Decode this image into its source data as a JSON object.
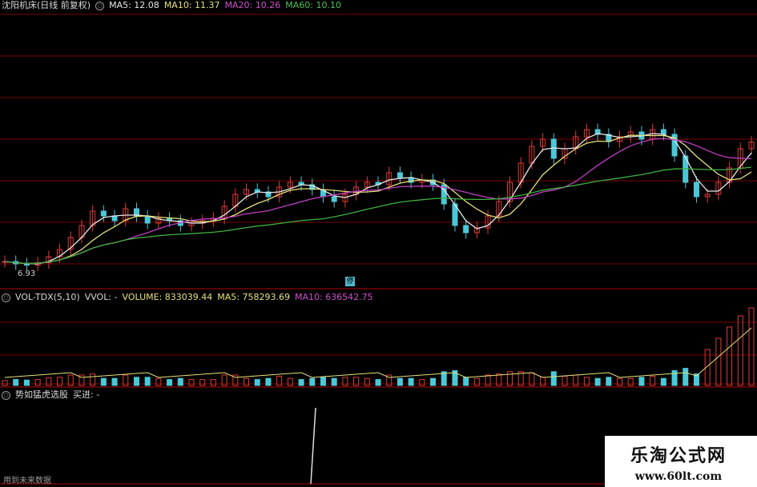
{
  "header": {
    "title": "沈阳机床(日线 前复权)",
    "ma5": "MA5: 12.08",
    "ma10": "MA10: 11.37",
    "ma20": "MA20: 10.26",
    "ma60": "MA60: 10.10"
  },
  "price_panel": {
    "low_label": "6.93",
    "stop_marker": "停"
  },
  "volume_header": {
    "name": "VOL-TDX(5,10)",
    "vvol": "VVOL: -",
    "volume": "VOLUME: 833039.44",
    "ma5": "MA5: 758293.69",
    "ma10": "MA10: 636542.75"
  },
  "indicator_header": {
    "name": "势如猛虎选股",
    "buy": "买进: -"
  },
  "footer": {
    "note": "用到未来数据"
  },
  "watermark": {
    "line1": "乐淘公式网",
    "line2": "www.60lt.com"
  },
  "colors": {
    "ma5": "#e8e8e8",
    "ma10": "#e6e07a",
    "ma20": "#c040c0",
    "ma60": "#40b040",
    "up": "#e03a3a",
    "down": "#4ac8d8",
    "grid": "#7a0000"
  },
  "chart_data": [
    {
      "type": "candlestick",
      "title": "沈阳机床(日线 前复权)",
      "series": [
        {
          "name": "MA5",
          "last": 12.08
        },
        {
          "name": "MA10",
          "last": 11.37
        },
        {
          "name": "MA20",
          "last": 10.26
        },
        {
          "name": "MA60",
          "last": 10.1
        }
      ],
      "annotations": [
        "6.93",
        "停"
      ],
      "close_trend": [
        7.1,
        7.0,
        6.95,
        7.05,
        7.3,
        7.6,
        8.1,
        8.6,
        9.2,
        9.0,
        8.8,
        9.3,
        9.0,
        8.7,
        8.9,
        8.8,
        8.6,
        8.7,
        8.8,
        8.9,
        9.4,
        9.9,
        10.1,
        10.0,
        9.8,
        10.2,
        10.4,
        10.3,
        10.1,
        9.8,
        9.6,
        9.9,
        10.2,
        10.4,
        10.3,
        10.8,
        10.6,
        10.4,
        10.5,
        10.3,
        9.5,
        8.6,
        8.3,
        8.5,
        9.0,
        9.6,
        10.4,
        11.2,
        11.9,
        12.2,
        11.4,
        11.8,
        12.3,
        12.6,
        12.4,
        12.1,
        12.3,
        12.5,
        12.2,
        12.6,
        12.4,
        11.5,
        10.4,
        9.8,
        9.9,
        10.4,
        11.0,
        11.8,
        12.08
      ]
    },
    {
      "type": "bar",
      "title": "VOL-TDX(5,10)",
      "series": [
        {
          "name": "VOLUME",
          "last": 833039.44
        },
        {
          "name": "MA5",
          "last": 758293.69
        },
        {
          "name": "MA10",
          "last": 636542.75
        }
      ]
    },
    {
      "type": "line",
      "title": "势如猛虎选股",
      "series": [
        {
          "name": "买进",
          "last": "-"
        }
      ]
    }
  ]
}
